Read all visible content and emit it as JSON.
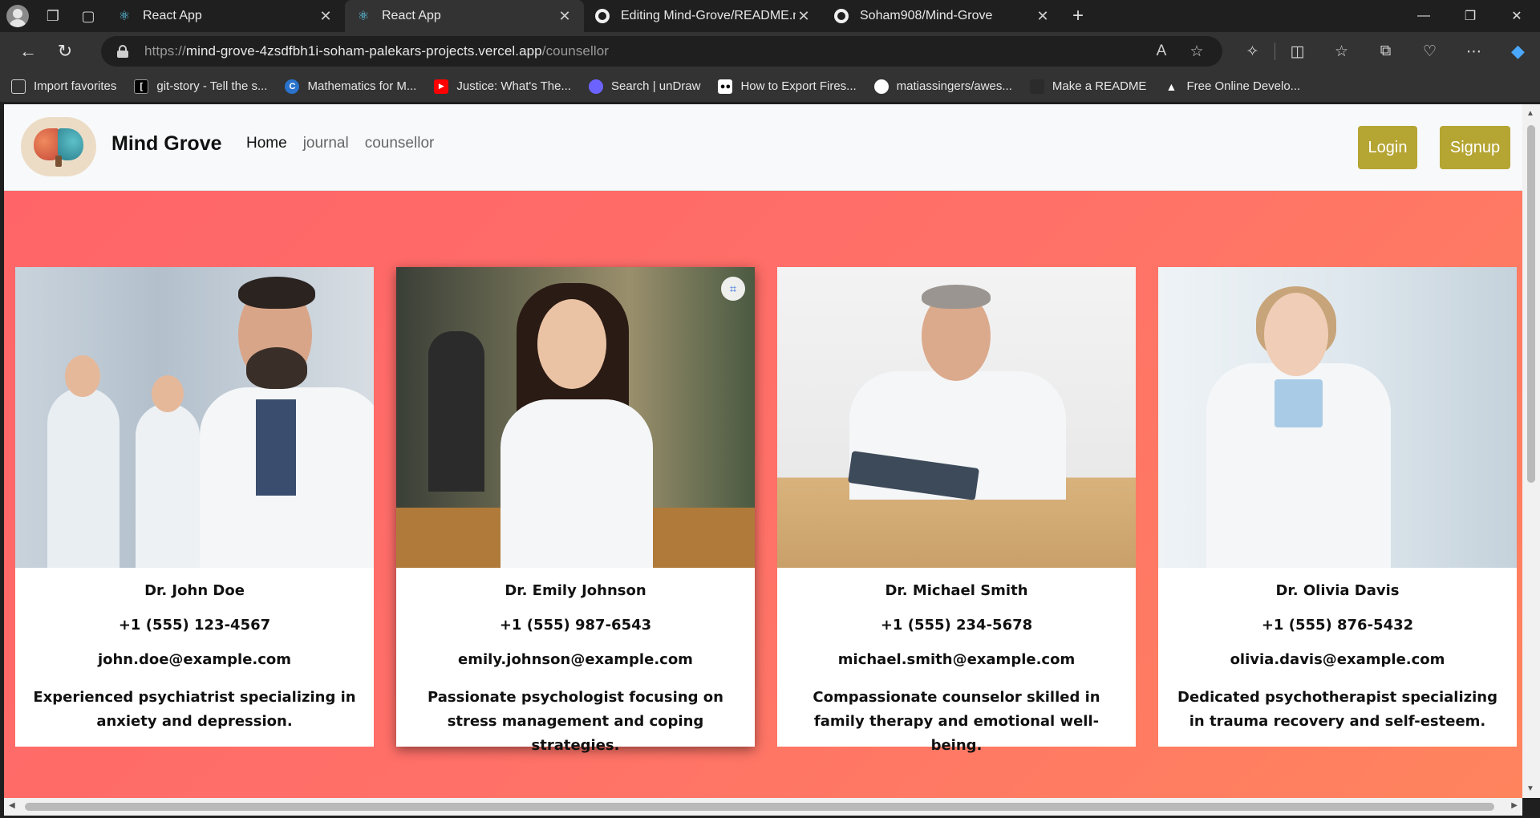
{
  "tabs": [
    {
      "title": "React App",
      "icon": "react-icon",
      "active": false
    },
    {
      "title": "React App",
      "icon": "react-icon",
      "active": true
    },
    {
      "title": "Editing Mind-Grove/README.md",
      "icon": "github-icon",
      "active": false
    },
    {
      "title": "Soham908/Mind-Grove",
      "icon": "github-icon",
      "active": false
    }
  ],
  "address": {
    "scheme": "https://",
    "host": "mind-grove-4zsdfbh1i-soham-palekars-projects.vercel.app",
    "path": "/counsellor"
  },
  "favorites": [
    {
      "label": "Import favorites",
      "icon": "import-icon",
      "color": "#cfcfcf"
    },
    {
      "label": "git-story - Tell the s...",
      "icon": "git-story-icon",
      "color": "#000000"
    },
    {
      "label": "Mathematics for M...",
      "icon": "coursera-icon",
      "color": "#2a73cc"
    },
    {
      "label": "Justice: What's The...",
      "icon": "youtube-icon",
      "color": "#ff0000"
    },
    {
      "label": "Search | unDraw",
      "icon": "undraw-icon",
      "color": "#6c63ff"
    },
    {
      "label": "How to Export Fires...",
      "icon": "medium-icon",
      "color": "#ffffff"
    },
    {
      "label": "matiassingers/awes...",
      "icon": "github-icon",
      "color": "#ffffff"
    },
    {
      "label": "Make a README",
      "icon": "readme-icon",
      "color": "#333333"
    },
    {
      "label": "Free Online Develo...",
      "icon": "triangle-icon",
      "color": "#ffffff"
    }
  ],
  "site": {
    "brand": "Mind Grove",
    "nav": [
      {
        "label": "Home",
        "active": true
      },
      {
        "label": "journal",
        "active": false
      },
      {
        "label": "counsellor",
        "active": false
      }
    ],
    "login_label": "Login",
    "signup_label": "Signup",
    "button_color": "#b5a533",
    "gradient": [
      "#ff6468",
      "#ff845e"
    ]
  },
  "counsellors": [
    {
      "name": "Dr. John Doe",
      "phone": "+1 (555) 123-4567",
      "email": "john.doe@example.com",
      "description": "Experienced psychiatrist specializing in anxiety and depression."
    },
    {
      "name": "Dr. Emily Johnson",
      "phone": "+1 (555) 987-6543",
      "email": "emily.johnson@example.com",
      "description": "Passionate psychologist focusing on stress management and coping strategies."
    },
    {
      "name": "Dr. Michael Smith",
      "phone": "+1 (555) 234-5678",
      "email": "michael.smith@example.com",
      "description": "Compassionate counselor skilled in family therapy and emotional well-being."
    },
    {
      "name": "Dr. Olivia Davis",
      "phone": "+1 (555) 876-5432",
      "email": "olivia.davis@example.com",
      "description": "Dedicated psychotherapist specializing in trauma recovery and self-esteem."
    }
  ]
}
